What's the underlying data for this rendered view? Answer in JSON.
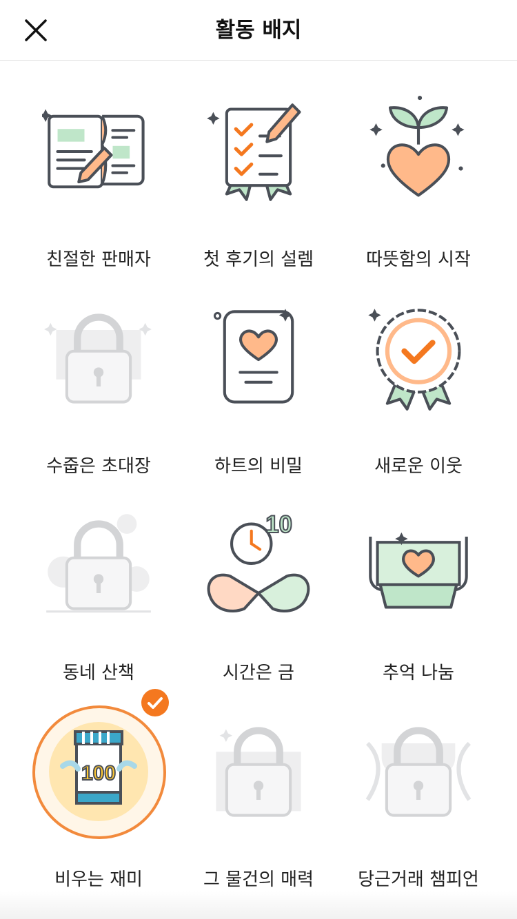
{
  "header": {
    "title": "활동 배지",
    "close_icon": "close-icon"
  },
  "badges": [
    {
      "label": "친절한 판매자",
      "icon": "document-pen-icon",
      "locked": false
    },
    {
      "label": "첫 후기의 설렘",
      "icon": "checklist-pen-icon",
      "locked": false
    },
    {
      "label": "따뜻함의 시작",
      "icon": "sprout-heart-icon",
      "locked": false
    },
    {
      "label": "수줍은 초대장",
      "icon": "lock-icon",
      "locked": true
    },
    {
      "label": "하트의 비밀",
      "icon": "heart-card-icon",
      "locked": false
    },
    {
      "label": "새로운 이웃",
      "icon": "check-rosette-icon",
      "locked": false
    },
    {
      "label": "동네 산책",
      "icon": "lock-icon",
      "locked": true
    },
    {
      "label": "시간은 금",
      "icon": "pinky-promise-clock-icon",
      "locked": false
    },
    {
      "label": "추억 나눔",
      "icon": "heart-box-icon",
      "locked": false
    },
    {
      "label": "비우는 재미",
      "icon": "store-100-icon",
      "locked": false,
      "selected": true
    },
    {
      "label": "그 물건의 매력",
      "icon": "lock-icon",
      "locked": true
    },
    {
      "label": "당근거래 챔피언",
      "icon": "lock-icon",
      "locked": true
    }
  ],
  "badge_text_100": "100",
  "badge_text_10": "10",
  "colors": {
    "accent": "#f4781f",
    "mint": "#bfe6c9",
    "peach": "#ffb98a",
    "ink": "#4a4f57",
    "locked": "#d9dadc"
  }
}
